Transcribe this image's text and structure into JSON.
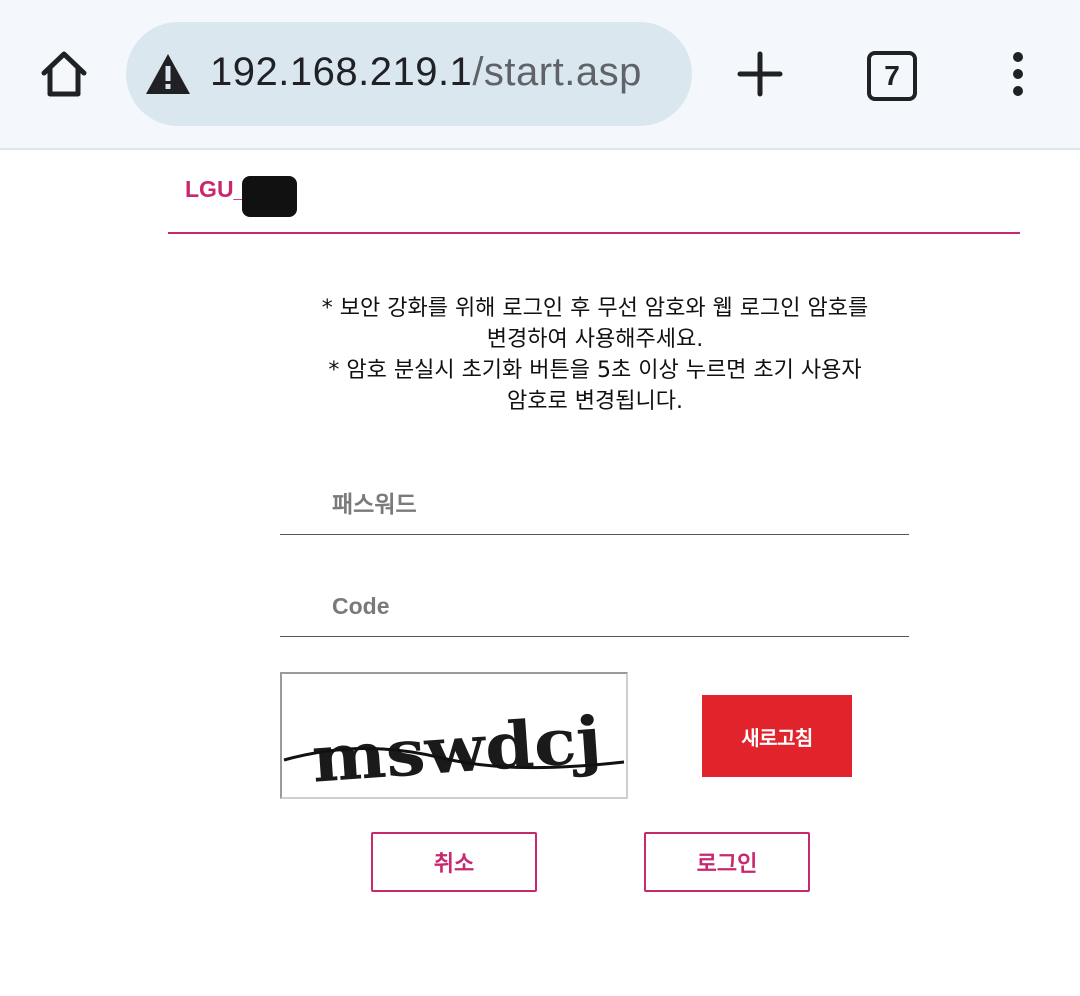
{
  "browser": {
    "url_host": "192.168.219.1",
    "url_path": "/start.asp",
    "tab_count": "7",
    "icons": [
      "home-icon",
      "warning-icon",
      "plus-icon",
      "tabs-icon",
      "menu-icon"
    ]
  },
  "header": {
    "brand": "LGU_",
    "accent_color": "#c8286e"
  },
  "notice": {
    "line1": "* 보안 강화를 위해 로그인 후 무선 암호와 웹 로그인 암호를",
    "line2": "변경하여 사용해주세요.",
    "line3": "* 암호 분실시 초기화 버튼을 5초 이상 누르면 초기 사용자",
    "line4": "암호로 변경됩니다."
  },
  "form": {
    "password_placeholder": "패스워드",
    "code_placeholder": "Code",
    "captcha_text": "mswdcj",
    "refresh_label": "새로고침",
    "refresh_color": "#e1232b",
    "cancel_label": "취소",
    "login_label": "로그인"
  }
}
